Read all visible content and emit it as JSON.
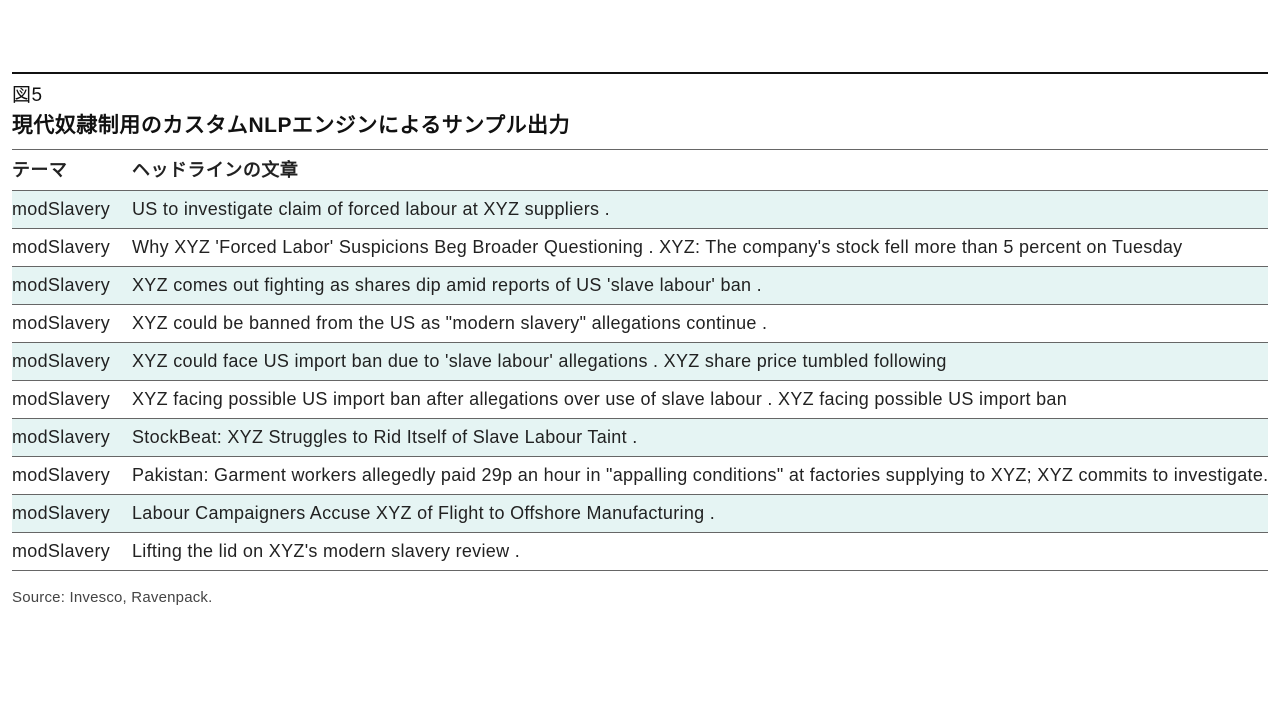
{
  "figure": {
    "number": "図5",
    "title": "現代奴隷制用のカスタムNLPエンジンによるサンプル出力",
    "source": "Source: Invesco, Ravenpack."
  },
  "table": {
    "headers": {
      "theme": "テーマ",
      "headline": "ヘッドラインの文章"
    },
    "rows": [
      {
        "theme": "modSlavery",
        "headline": "US to investigate claim of forced labour at XYZ suppliers ."
      },
      {
        "theme": "modSlavery",
        "headline": "Why XYZ 'Forced Labor' Suspicions Beg Broader Questioning . XYZ: The company's stock fell more than 5 percent on Tuesday"
      },
      {
        "theme": "modSlavery",
        "headline": "XYZ comes out fighting as shares dip amid reports of US 'slave labour' ban ."
      },
      {
        "theme": "modSlavery",
        "headline": "XYZ could be banned from the US as \"modern slavery\" allegations continue ."
      },
      {
        "theme": "modSlavery",
        "headline": "XYZ could face US import ban due to 'slave labour' allegations . XYZ share price tumbled following"
      },
      {
        "theme": "modSlavery",
        "headline": "XYZ facing possible US import ban after allegations over use of slave labour . XYZ facing possible US import ban"
      },
      {
        "theme": "modSlavery",
        "headline": "StockBeat: XYZ Struggles to Rid Itself of Slave Labour Taint ."
      },
      {
        "theme": "modSlavery",
        "headline": "Pakistan: Garment workers allegedly paid 29p an hour in \"appalling conditions\" at factories supplying to XYZ; XYZ commits to investigate."
      },
      {
        "theme": "modSlavery",
        "headline": "Labour Campaigners Accuse XYZ of Flight to Offshore Manufacturing ."
      },
      {
        "theme": "modSlavery",
        "headline": "Lifting the lid on XYZ's modern slavery review ."
      }
    ]
  }
}
